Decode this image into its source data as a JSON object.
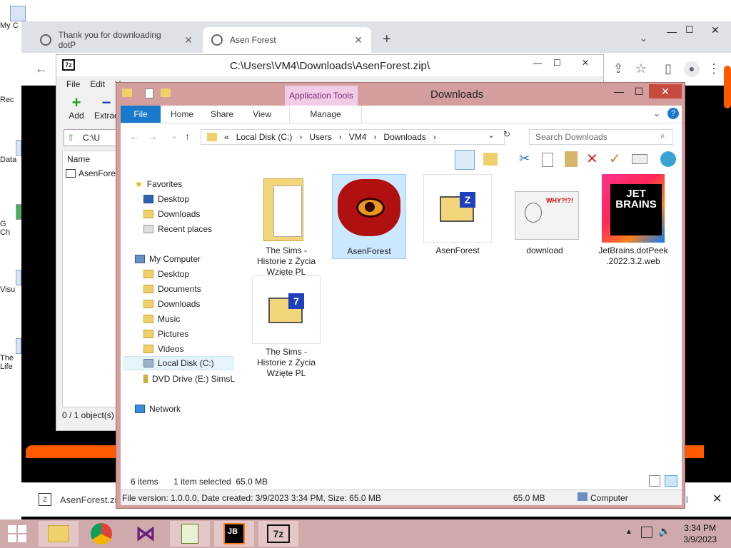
{
  "desktop": {
    "icons": [
      "My C",
      "Rec",
      "Data",
      "G\nCh",
      "Visu",
      "The\nLife"
    ]
  },
  "chrome": {
    "tabs": [
      {
        "label": "Thank you for downloading dotP"
      },
      {
        "label": "Asen Forest"
      }
    ],
    "new_tab": "+",
    "download": {
      "file": "AsenForest.zi",
      "show_all": "ll"
    }
  },
  "sevenzip": {
    "title": "C:\\Users\\VM4\\Downloads\\AsenForest.zip\\",
    "menu": [
      "File",
      "Edit",
      "V"
    ],
    "tools": [
      "Add",
      "Extrac"
    ],
    "address": "C:\\U",
    "column": "Name",
    "row": "AsenFores",
    "status": "0 / 1 object(s)"
  },
  "explorer": {
    "title": "Downloads",
    "app_tools": "Application Tools",
    "ribbon_tabs": [
      "File",
      "Home",
      "Share",
      "View",
      "Manage"
    ],
    "breadcrumb": [
      "Local Disk (C:)",
      "Users",
      "VM4",
      "Downloads"
    ],
    "crumb_prefix": "«",
    "search_placeholder": "Search Downloads",
    "nav": {
      "favorites": "Favorites",
      "fav_items": [
        "Desktop",
        "Downloads",
        "Recent places"
      ],
      "computer": "My Computer",
      "computer_items": [
        "Desktop",
        "Documents",
        "Downloads",
        "Music",
        "Pictures",
        "Videos",
        "Local Disk (C:)",
        "DVD Drive (E:) SimsL"
      ],
      "network": "Network"
    },
    "files": [
      {
        "name": "The Sims -\nHistorie z Życia\nWzięte PL",
        "kind": "folder"
      },
      {
        "name": "AsenForest",
        "kind": "exe"
      },
      {
        "name": "AsenForest",
        "kind": "zip"
      },
      {
        "name": "download",
        "kind": "image"
      },
      {
        "name": "JetBrains.dotPeek\n.2022.3.2.web",
        "kind": "jetbrains"
      },
      {
        "name": "The Sims -\nHistorie z Życia\nWzięte PL",
        "kind": "7z"
      }
    ],
    "status": {
      "items": "6 items",
      "selected": "1 item selected  65.0 MB"
    },
    "info": {
      "details": "File version: 1.0.0.0, Date created: 3/9/2023 3:34 PM, Size: 65.0 MB",
      "size": "65.0 MB",
      "location": "Computer"
    },
    "jetbrains_text": "JET\nBRAINS",
    "meme_text": "WHY?!?!"
  },
  "taskbar": {
    "time": "3:34 PM",
    "date": "3/9/2023",
    "jb_label": "JB",
    "sevenzip_label": "7z"
  }
}
